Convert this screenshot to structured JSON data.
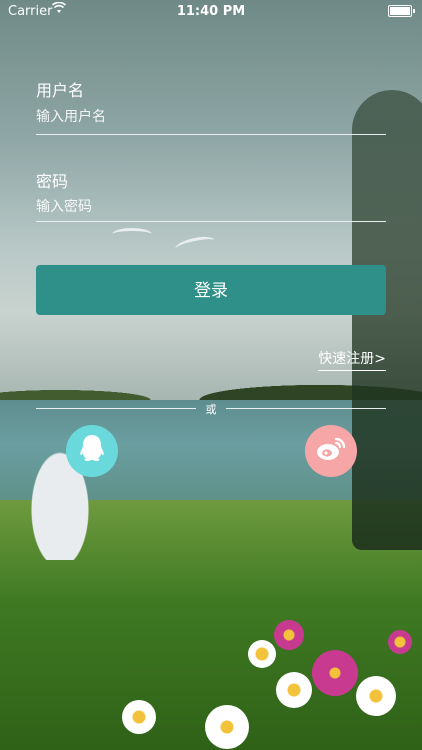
{
  "status_bar": {
    "carrier": "Carrier",
    "time": "11:40 PM"
  },
  "form": {
    "username_label": "用户名",
    "username_placeholder": "输入用户名",
    "password_label": "密码",
    "password_placeholder": "输入密码",
    "login_label": "登录",
    "register_link": "快速注册>",
    "or_text": "或"
  },
  "social": {
    "qq_icon": "qq-icon",
    "weibo_icon": "weibo-icon"
  },
  "colors": {
    "login_button": "#2e9088",
    "qq_circle": "#6ad9dc",
    "weibo_circle": "#f6a6a6"
  }
}
